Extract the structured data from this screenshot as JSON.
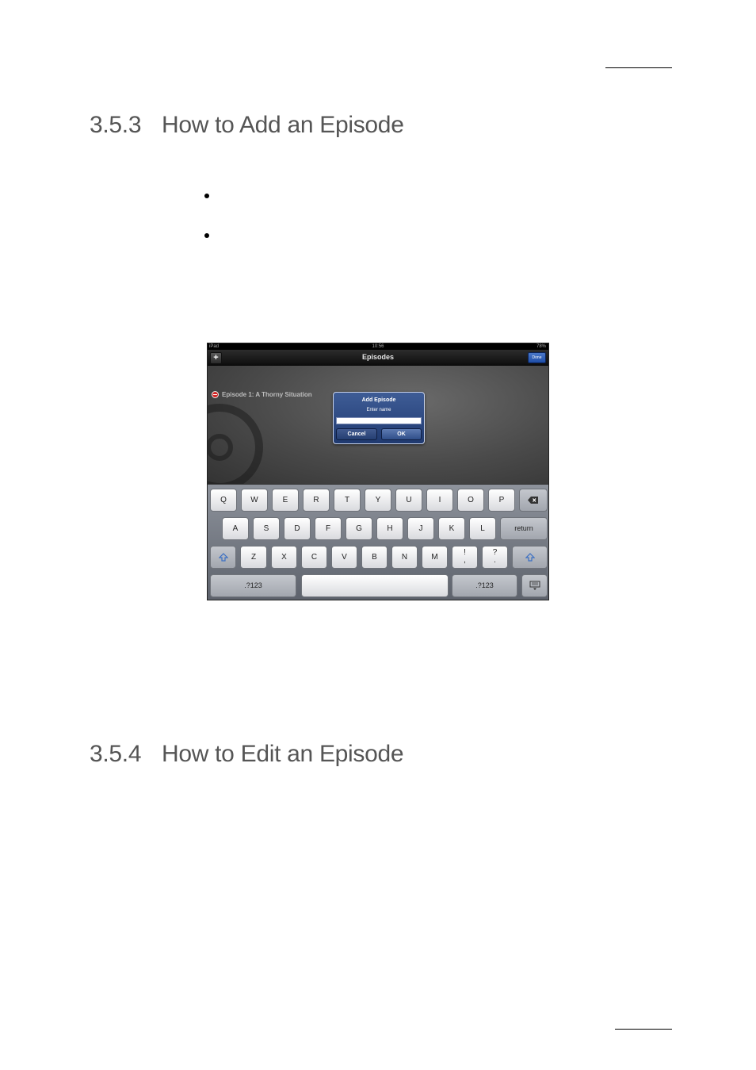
{
  "headings": {
    "section1_number": "3.5.3",
    "section1_title": "How to Add an Episode",
    "section2_number": "3.5.4",
    "section2_title": "How to Edit an Episode"
  },
  "screenshot": {
    "status": {
      "left": "iPad",
      "time": "10:56",
      "battery": "78%"
    },
    "nav": {
      "add_label": "+",
      "title": "Episodes",
      "done_label": "Done"
    },
    "episode_row": "Episode 1: A Thorny Situation",
    "dialog": {
      "title": "Add Episode",
      "message": "Enter name",
      "input_value": "",
      "cancel_label": "Cancel",
      "ok_label": "OK"
    },
    "keyboard": {
      "row1": [
        "Q",
        "W",
        "E",
        "R",
        "T",
        "Y",
        "U",
        "I",
        "O",
        "P"
      ],
      "row2": [
        "A",
        "S",
        "D",
        "F",
        "G",
        "H",
        "J",
        "K",
        "L"
      ],
      "return_label": "return",
      "row3": [
        "Z",
        "X",
        "C",
        "V",
        "B",
        "N",
        "M"
      ],
      "punct1_top": "!",
      "punct1_bottom": ",",
      "punct2_top": "?",
      "punct2_bottom": ".",
      "numbers_left": ".?123",
      "numbers_right": ".?123",
      "space_label": ""
    }
  }
}
